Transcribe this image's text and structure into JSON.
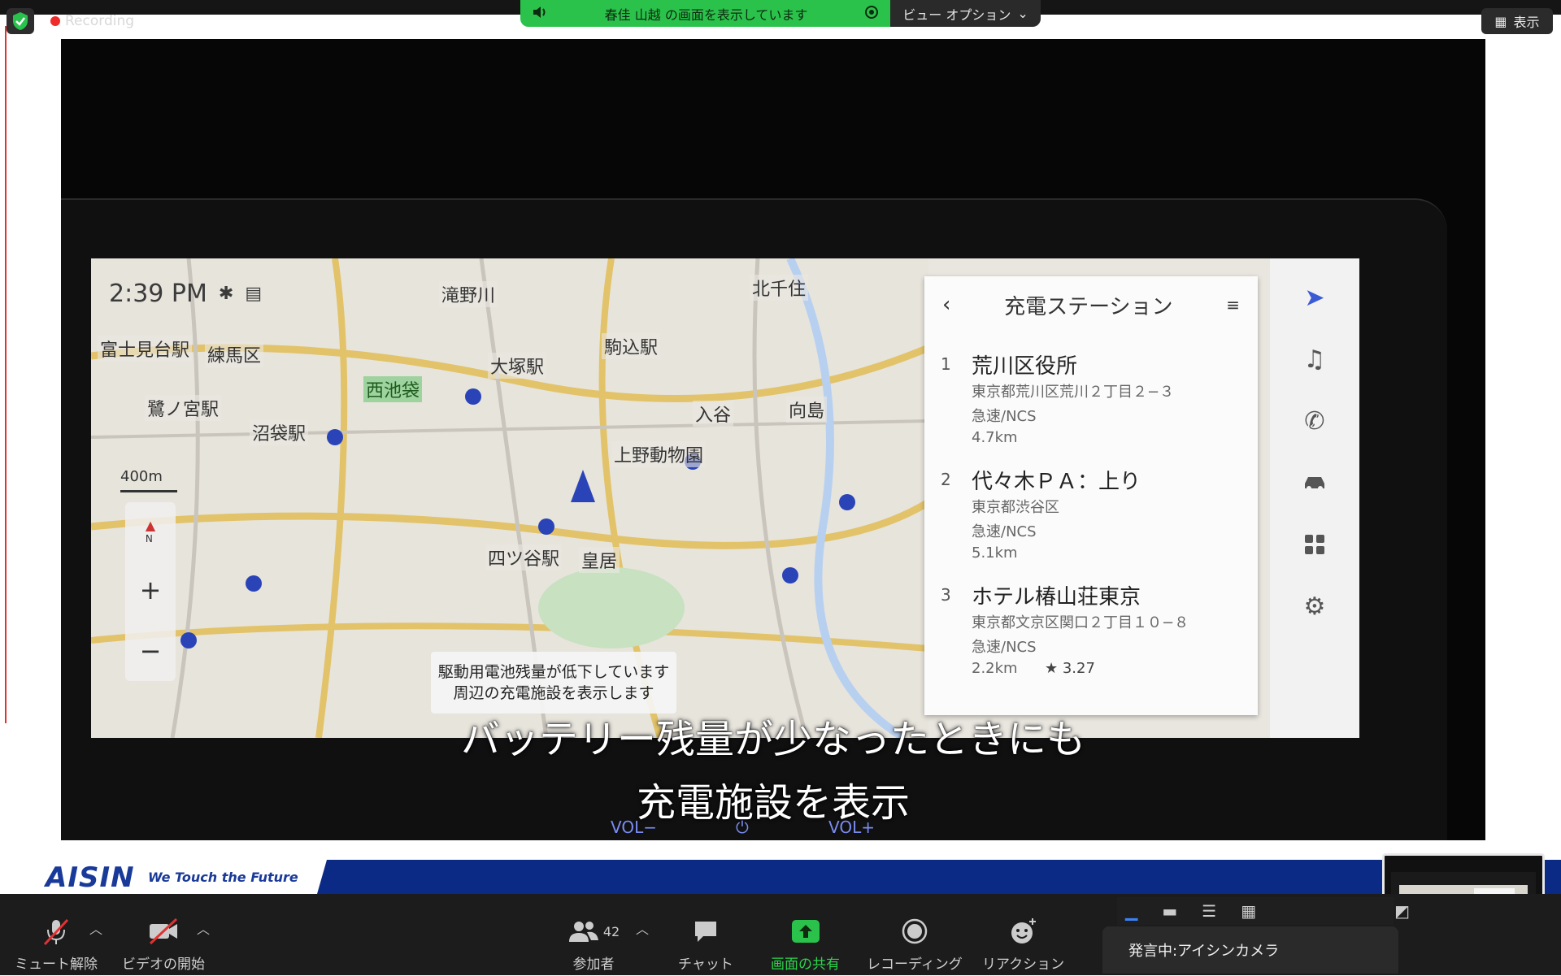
{
  "top": {
    "recording_label": "Recording",
    "share_status": "春佳 山越 の画面を表示しています",
    "view_options_label": "ビュー オプション",
    "display_label": "表示"
  },
  "nav_screen": {
    "time": "2:39 PM",
    "scale_label": "400m",
    "zoom_in": "+",
    "zoom_out": "−",
    "north": "N",
    "places": [
      "滝野川",
      "大塚駅",
      "西池袋",
      "練馬区",
      "富士見台駅",
      "鷺ノ宮駅",
      "沼袋駅",
      "駒込駅",
      "北千住",
      "入谷",
      "向島",
      "上野動物園",
      "四ツ谷駅",
      "皇居"
    ],
    "banner_line1": "駆動用電池残量が低下しています",
    "banner_line2": "周辺の充電施設を表示します",
    "panel_title": "充電ステーション",
    "results": [
      {
        "num": "1",
        "name": "荒川区役所",
        "address": "東京都荒川区荒川２丁目２−３",
        "type": "急速/NCS",
        "distance": "4.7km"
      },
      {
        "num": "2",
        "name": "代々木ＰＡ：上り",
        "address": "東京都渋谷区",
        "type": "急速/NCS",
        "distance": "5.1km"
      },
      {
        "num": "3",
        "name": "ホテル椿山荘東京",
        "address": "東京都文京区関口２丁目１０−８",
        "type": "急速/NCS",
        "distance": "2.2km",
        "rating": "★ 3.27"
      }
    ]
  },
  "captions": {
    "line1": "バッテリー残量が少なったときにも",
    "line2": "充電施設を表示",
    "vol_minus": "VOL−",
    "vol_plus": "VOL+"
  },
  "brand": {
    "logo": "AISIN",
    "tagline": "We Touch the Future"
  },
  "toolbar": {
    "mute_label": "ミュート解除",
    "video_label": "ビデオの開始",
    "participants_label": "参加者",
    "participants_count": "42",
    "chat_label": "チャット",
    "share_label": "画面の共有",
    "record_label": "レコーディング",
    "reaction_label": "リアクション",
    "speaker_label": "発言中:アイシンカメラ"
  },
  "colors": {
    "share_green": "#2bc24b",
    "toolbar_bg": "#1c1c1c",
    "brand_blue": "#0b2a86"
  }
}
